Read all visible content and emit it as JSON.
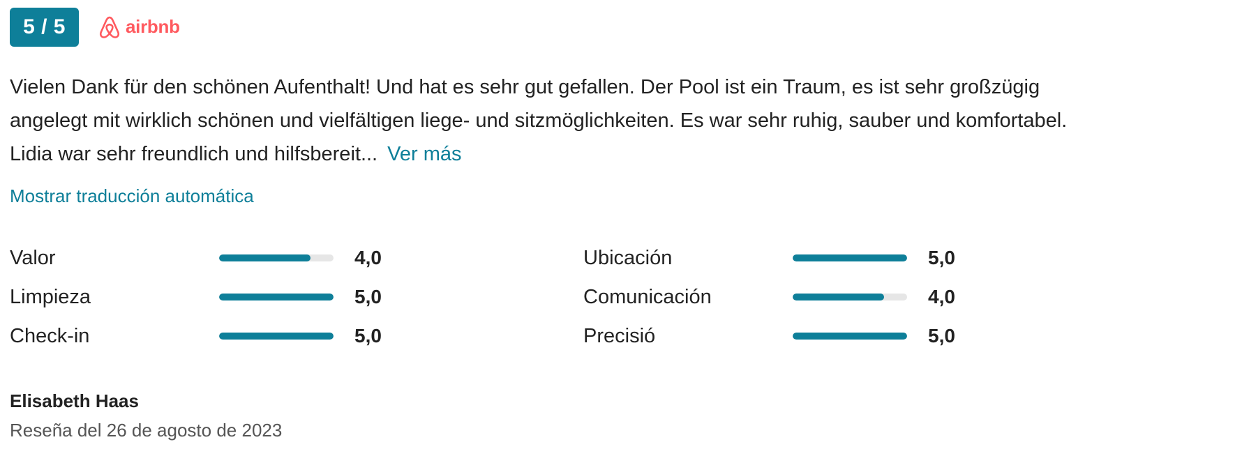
{
  "header": {
    "score": "5 / 5",
    "brand": "airbnb",
    "brand_icon": "airbnb-logo-icon",
    "accent_color": "#0e7f99",
    "brand_color": "#ff5a5f"
  },
  "review": {
    "text_line1": "Vielen Dank für den schönen Aufenthalt! Und hat es sehr gut gefallen. Der Pool ist ein Traum, es ist sehr großzügig",
    "text_line2": "angelegt mit wirklich schönen und vielfältigen liege- und sitzmöglichkeiten. Es war sehr ruhig, sauber und komfortabel.",
    "text_line3": "Lidia war sehr freundlich und hilfsbereit...",
    "see_more": "Ver más",
    "translate_link": "Mostrar traducción automática"
  },
  "ratings": [
    {
      "label": "Valor",
      "value": "4,0",
      "fraction": 0.8
    },
    {
      "label": "Limpieza",
      "value": "5,0",
      "fraction": 1.0
    },
    {
      "label": "Check-in",
      "value": "5,0",
      "fraction": 1.0
    },
    {
      "label": "Ubicación",
      "value": "5,0",
      "fraction": 1.0
    },
    {
      "label": "Comunicación",
      "value": "4,0",
      "fraction": 0.8
    },
    {
      "label": "Precisió",
      "value": "5,0",
      "fraction": 1.0
    }
  ],
  "author": {
    "name": "Elisabeth Haas",
    "date": "Reseña del 26 de agosto de 2023"
  }
}
